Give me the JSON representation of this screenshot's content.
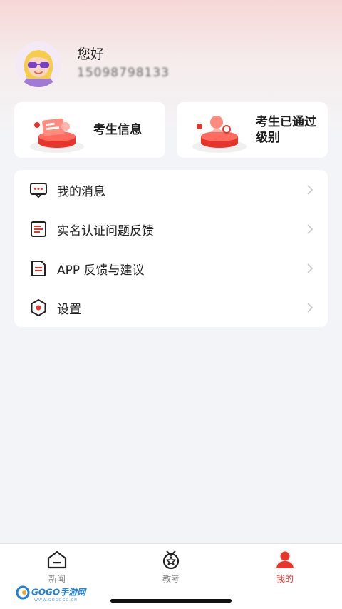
{
  "profile": {
    "greeting": "您好",
    "phone": "15098798133"
  },
  "cards": [
    {
      "label": "考生信息",
      "icon": "id-card-icon"
    },
    {
      "label": "考生已通过级别",
      "icon": "certificate-icon"
    }
  ],
  "menu": {
    "items": [
      {
        "label": "我的消息",
        "icon": "message-icon"
      },
      {
        "label": "实名认证问题反馈",
        "icon": "document-list-icon"
      },
      {
        "label": "APP 反馈与建议",
        "icon": "feedback-icon"
      },
      {
        "label": "设置",
        "icon": "settings-icon"
      }
    ]
  },
  "bottom_nav": {
    "items": [
      {
        "label": "新闻",
        "icon": "news-home-icon",
        "active": false
      },
      {
        "label": "教考",
        "icon": "medal-icon",
        "active": false
      },
      {
        "label": "我的",
        "icon": "user-icon",
        "active": true
      }
    ]
  },
  "watermark": {
    "text": "GOGO手游网",
    "sub": "WWW.GOGOGO.CN"
  },
  "colors": {
    "accent": "#e8352c",
    "background": "#f3f4f7",
    "card": "#ffffff"
  }
}
